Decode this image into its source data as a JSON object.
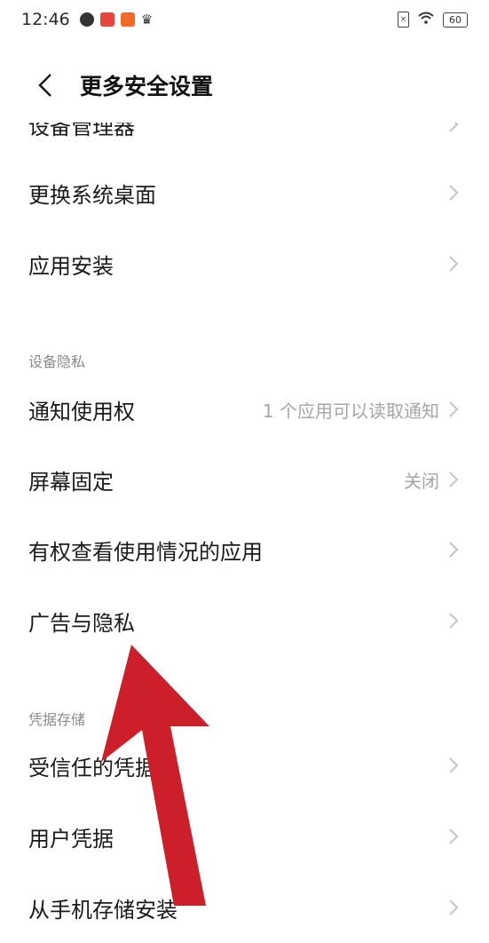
{
  "status_bar": {
    "time": "12:46",
    "battery": "60"
  },
  "header": {
    "title": "更多安全设置"
  },
  "items": [
    {
      "label": "设备管理器",
      "value": ""
    },
    {
      "label": "更换系统桌面",
      "value": ""
    },
    {
      "label": "应用安装",
      "value": ""
    },
    {
      "label": "通知使用权",
      "value": "1 个应用可以读取通知"
    },
    {
      "label": "屏幕固定",
      "value": "关闭"
    },
    {
      "label": "有权查看使用情况的应用",
      "value": ""
    },
    {
      "label": "广告与隐私",
      "value": ""
    },
    {
      "label": "受信任的凭据",
      "value": ""
    },
    {
      "label": "用户凭据",
      "value": ""
    },
    {
      "label": "从手机存储安装",
      "value": ""
    }
  ],
  "sections": {
    "device_privacy": "设备隐私",
    "credential_storage": "凭据存储"
  },
  "colors": {
    "arrow": "#cc1f2a",
    "secondary_text": "#a6a6a6"
  }
}
